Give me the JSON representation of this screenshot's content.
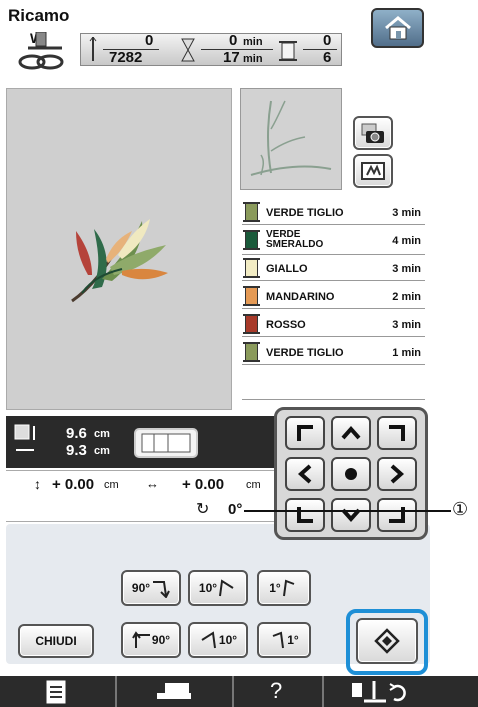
{
  "title": "Ricamo",
  "header": {
    "presser_foot": "W",
    "stitch_current": "0",
    "stitch_total": "7282",
    "time_current": "0",
    "time_total": "17",
    "time_unit": "min",
    "color_current": "0",
    "color_total": "6"
  },
  "colors": [
    {
      "name": "VERDE TIGLIO",
      "time": "3 min",
      "swatch": "#8a9a5b"
    },
    {
      "name": "VERDE SMERALDO",
      "line1": "VERDE",
      "line2": "SMERALDO",
      "time": "4 min",
      "swatch": "#1a5a3a"
    },
    {
      "name": "GIALLO",
      "time": "3 min",
      "swatch": "#f2ecc4"
    },
    {
      "name": "MANDARINO",
      "time": "2 min",
      "swatch": "#e59a55"
    },
    {
      "name": "ROSSO",
      "time": "3 min",
      "swatch": "#a83a2a"
    },
    {
      "name": "VERDE TIGLIO",
      "time": "1 min",
      "swatch": "#8a9a5b"
    }
  ],
  "size": {
    "height": "9.6",
    "width": "9.3",
    "unit": "cm"
  },
  "offset": {
    "vertical": "+ 0.00",
    "horizontal": "+ 0.00",
    "unit": "cm",
    "rotation": "0°"
  },
  "callout": "①",
  "buttons": {
    "rot_right_90": "90°",
    "rot_right_10": "10°",
    "rot_right_1": "1°",
    "rot_left_90": "90°",
    "rot_left_10": "10°",
    "rot_left_1": "1°",
    "close": "CHIUDI"
  },
  "bottom_bar": {
    "help": "?"
  }
}
